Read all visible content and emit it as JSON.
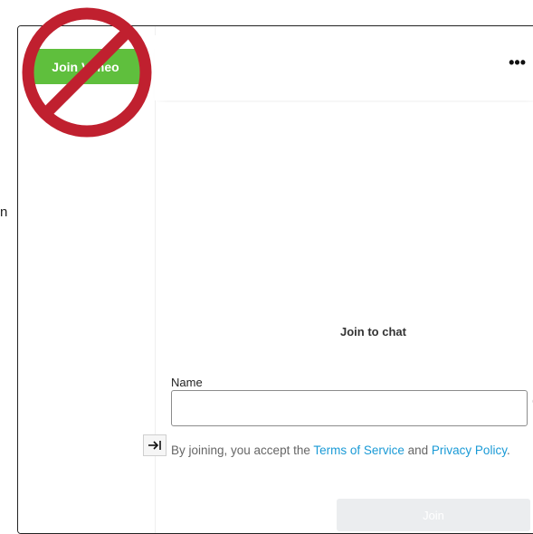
{
  "page": {
    "stray_text": "n"
  },
  "sidebar": {
    "join_button_label": "Join Vimeo"
  },
  "header": {
    "more_label": "•••"
  },
  "chat": {
    "title": "Join to chat",
    "name_label": "Name",
    "name_value": "",
    "name_placeholder": "",
    "cut_char": "(",
    "terms_prefix": "By joining, you accept the ",
    "terms_link": "Terms of Service",
    "terms_and": " and ",
    "privacy_link": "Privacy Policy",
    "terms_suffix": ".",
    "join_label": "Join"
  },
  "icons": {
    "overlay": "no-sign-icon",
    "collapse": "arrow-right-to-bar-icon",
    "no_sign_color": "#c0202f",
    "brand_green": "#5fbf3d",
    "link_color": "#1a9ad6"
  }
}
